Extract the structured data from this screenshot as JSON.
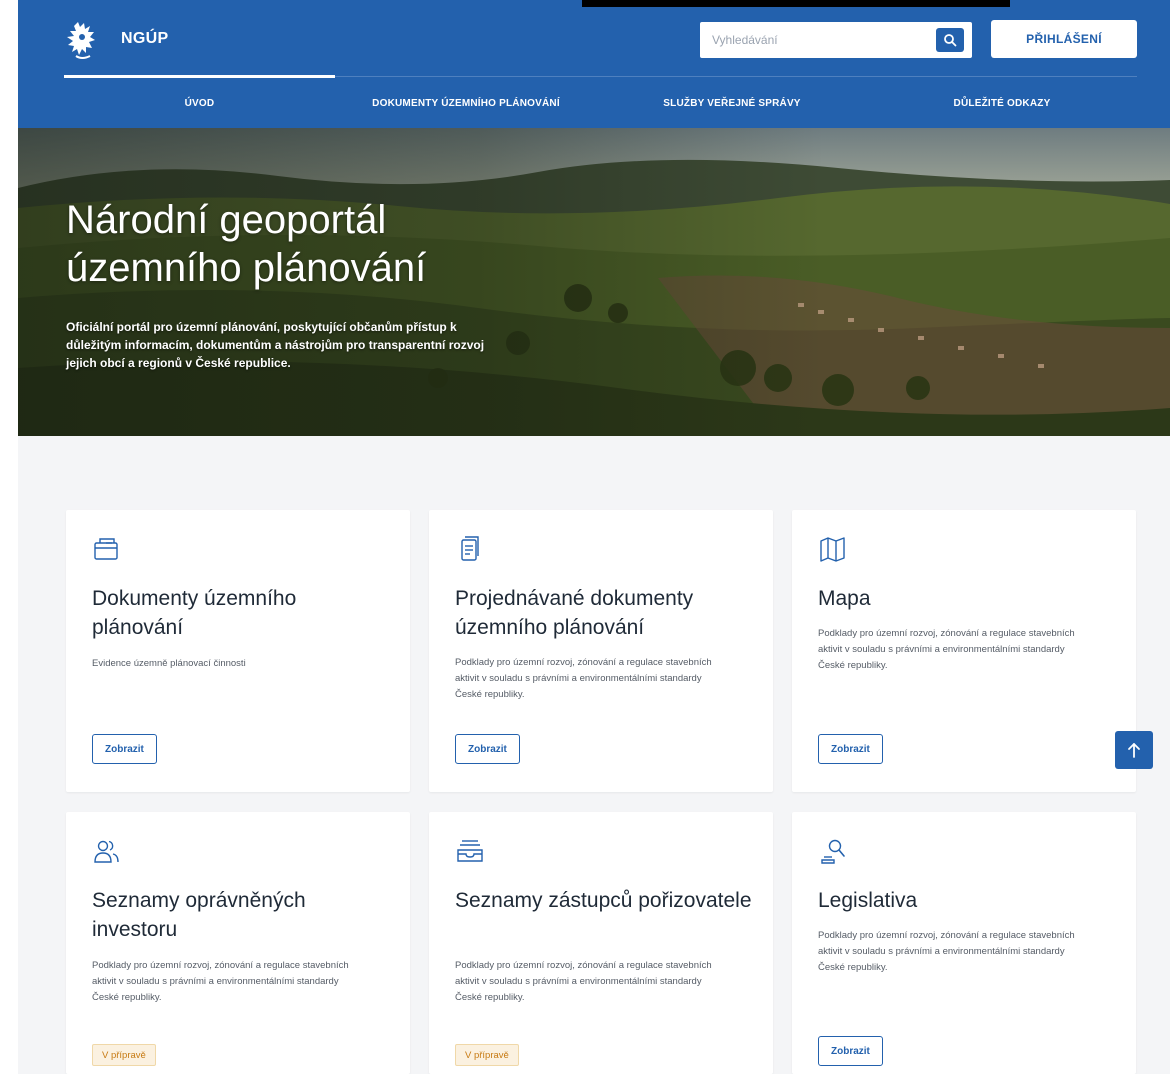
{
  "header": {
    "brand": "NGÚP",
    "search_placeholder": "Vyhledávání",
    "login_label": "PŘIHLÁŠENÍ",
    "colors": {
      "primary": "#2361ad"
    }
  },
  "nav": {
    "items": [
      {
        "label": "ÚVOD",
        "active": true
      },
      {
        "label": "DOKUMENTY ÚZEMNÍHO PLÁNOVÁNÍ",
        "active": false
      },
      {
        "label": "SLUŽBY VEŘEJNÉ SPRÁVY",
        "active": false
      },
      {
        "label": "DŮLEŽITÉ ODKAZY",
        "active": false
      }
    ]
  },
  "hero": {
    "title_line1": "Národní geoportál",
    "title_line2": "územního plánování",
    "subtitle": "Oficiální portál pro územní plánování, poskytující občanům přístup k důležitým informacím, dokumentům a nástrojům pro transparentní rozvoj jejich obcí a regionů v České republice."
  },
  "cards": [
    {
      "icon": "folder-icon",
      "title": "Dokumenty územního plánování",
      "description": "Evidence územně plánovací činnosti",
      "button": "Zobrazit"
    },
    {
      "icon": "document-icon",
      "title": "Projednávané dokumenty územního plánování",
      "description": "Podklady pro územní rozvoj, zónování a regulace stavebních aktivit v souladu s právními a environmentálními standardy České republiky.",
      "button": "Zobrazit"
    },
    {
      "icon": "map-icon",
      "title": "Mapa",
      "description": "Podklady pro územní rozvoj, zónování a regulace stavebních aktivit v souladu s právními a environmentálními standardy České republiky.",
      "button": "Zobrazit"
    },
    {
      "icon": "users-icon",
      "title": "Seznamy oprávněných investoru",
      "description": "Podklady pro územní rozvoj, zónování a regulace stavebních aktivit v souladu s právními a environmentálními standardy České republiky.",
      "badge": "V přípravě"
    },
    {
      "icon": "inbox-icon",
      "title": "Seznamy zástupců pořizovatele",
      "description": "Podklady pro územní rozvoj, zónování a regulace stavebních aktivit v souladu s právními a environmentálními standardy České republiky.",
      "badge": "V přípravě"
    },
    {
      "icon": "gavel-icon",
      "title": "Legislativa",
      "description": "Podklady pro územní rozvoj, zónování a regulace stavebních aktivit v souladu s právními a environmentálními standardy České republiky.",
      "button": "Zobrazit"
    }
  ],
  "scroll_top": {
    "icon": "arrow-up-icon"
  }
}
